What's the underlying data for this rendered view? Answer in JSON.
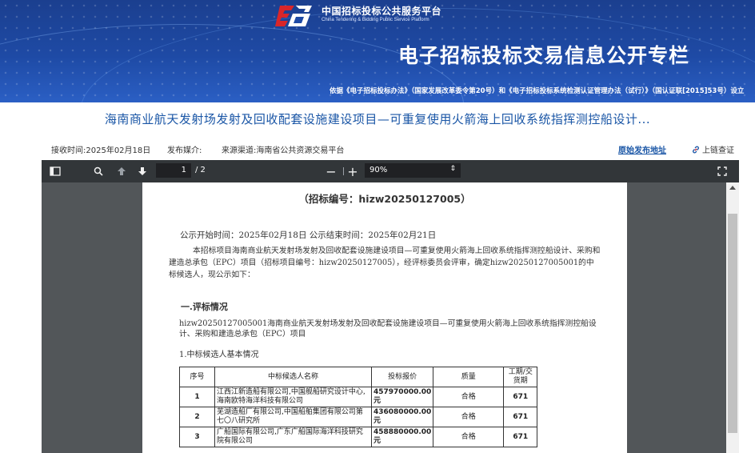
{
  "banner": {
    "logo_cn": "中国招标投标公共服务平台",
    "logo_en": "China Tendering & Bidding Public Service Platform",
    "title": "电子招标投标交易信息公开专栏",
    "basis": "依据《电子招标投标办法》（国家发展改革委令第20号）和《电子招标投标系统检测认证管理办法（试行）》（国认证联[2015]53号）设立"
  },
  "article": {
    "title": "海南商业航天发射场发射及回收配套设施建设项目—可重复使用火箭海上回收系统指挥测控船设计..."
  },
  "meta": {
    "receive_time": "接收时间:2025年02月18日",
    "media_label": "发布媒介:",
    "source": "来源渠道:海南省公共资源交易平台",
    "original_link": "原始发布地址",
    "chain_check": "上链查证"
  },
  "viewer": {
    "page_current": "1",
    "page_total": "/ 2",
    "zoom": "90%"
  },
  "pdf": {
    "code_line": "（招标编号：hizw20250127005）",
    "times": "公示开始时间：2025年02月18日    公示结束时间：2025年02月21日",
    "para": "本招标项目海南商业航天发射场发射及回收配套设施建设项目—可重复使用火箭海上回收系统指挥测控船设计、采购和建造总承包（EPC）项目（招标项目编号：hizw20250127005），经评标委员会评审，确定hizw20250127005001的中标候选人，现公示如下：",
    "section1": "一.评标情况",
    "para2": "hizw20250127005001海南商业航天发射场发射及回收配套设施建设项目—可重复使用火箭海上回收系统指挥测控船设计、采购和建造总承包（EPC）项目",
    "sub1": "1.中标候选人基本情况",
    "table": {
      "headers": [
        "序号",
        "中标候选人名称",
        "投标报价",
        "质量",
        "工期/交货期"
      ],
      "rows": [
        {
          "idx": "1",
          "name": "江西江新造船有限公司,中国舰船研究设计中心,海南欧特海洋科技有限公司",
          "price": "457970000.00元",
          "quality": "合格",
          "duration": "671"
        },
        {
          "idx": "2",
          "name": "芜湖造船厂有限公司,中国船舶集团有限公司第七〇八研究所",
          "price": "436080000.00元",
          "quality": "合格",
          "duration": "671"
        },
        {
          "idx": "3",
          "name": "广船国际有限公司,广东广船国际海洋科技研究院有限公司",
          "price": "458880000.00元",
          "quality": "合格",
          "duration": "671"
        }
      ]
    }
  },
  "colors": {
    "banner_blue": "#1e4aa5",
    "title_blue": "#1a56a6",
    "toolbar": "#323639",
    "viewer_bg": "#525659",
    "logo_red": "#d9262a"
  }
}
